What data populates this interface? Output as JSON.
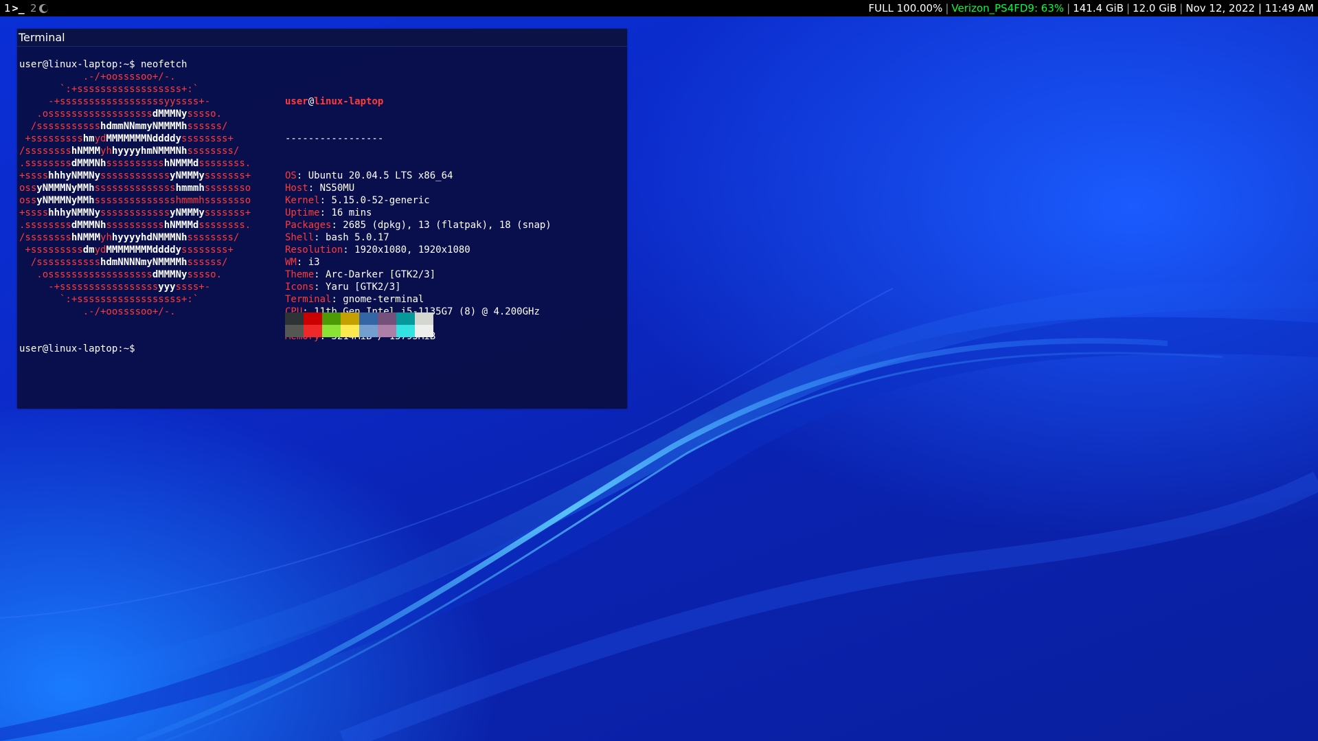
{
  "bar": {
    "workspaces": [
      {
        "num": "1",
        "icon": ">_",
        "focused": true
      },
      {
        "num": "2",
        "icon": "moon-icon",
        "focused": false
      }
    ],
    "status": {
      "battery": "FULL 100.00%",
      "wifi": "Verizon_PS4FD9: 63%",
      "disk": "141.4 GiB",
      "memory": "12.0 GiB",
      "datetime": "Nov 12, 2022 | 11:49 AM"
    },
    "colors": {
      "background": "#000000",
      "wifi_ok": "#00ff3a"
    }
  },
  "terminal": {
    "title": "Terminal",
    "command_line": "user@linux-laptop:~$ neofetch",
    "prompt": "user@linux-laptop:~$",
    "logo_color": "#ff3b3b",
    "logo": [
      [
        [
          "r",
          "           .-/+oossssoo+/-."
        ]
      ],
      [
        [
          "r",
          "       `:+ssssssssssssssssss+:`"
        ]
      ],
      [
        [
          "r",
          "     -+ssssssssssssssssssyyssss+-"
        ]
      ],
      [
        [
          "r",
          "   .ossssssssssssssssss"
        ],
        [
          "w",
          "dMMMNy"
        ],
        [
          "r",
          "sssso."
        ]
      ],
      [
        [
          "r",
          "  /sssssssssss"
        ],
        [
          "w",
          "hdmmNNmmyNMMMMh"
        ],
        [
          "r",
          "ssssss/"
        ]
      ],
      [
        [
          "r",
          " +sssssssss"
        ],
        [
          "w",
          "hm"
        ],
        [
          "r",
          "yd"
        ],
        [
          "w",
          "MMMMMMMNddddy"
        ],
        [
          "r",
          "ssssssss+"
        ]
      ],
      [
        [
          "r",
          "/ssssssss"
        ],
        [
          "w",
          "hNMMM"
        ],
        [
          "r",
          "yh"
        ],
        [
          "w",
          "hyyyyhmNMMMNh"
        ],
        [
          "r",
          "ssssssss/"
        ]
      ],
      [
        [
          "r",
          ".ssssssss"
        ],
        [
          "w",
          "dMMMNh"
        ],
        [
          "r",
          "ssssssssss"
        ],
        [
          "w",
          "hNMMMd"
        ],
        [
          "r",
          "ssssssss."
        ]
      ],
      [
        [
          "r",
          "+ssss"
        ],
        [
          "w",
          "hhhyNMMNy"
        ],
        [
          "r",
          "ssssssssssss"
        ],
        [
          "w",
          "yNMMMy"
        ],
        [
          "r",
          "sssssss+"
        ]
      ],
      [
        [
          "r",
          "oss"
        ],
        [
          "w",
          "yNMMMNyMMh"
        ],
        [
          "r",
          "ssssssssssssss"
        ],
        [
          "w",
          "hmmmh"
        ],
        [
          "r",
          "ssssssso"
        ]
      ],
      [
        [
          "r",
          "oss"
        ],
        [
          "w",
          "yNMMMNyMMh"
        ],
        [
          "r",
          "sssssssssssssshmmmhssssssso"
        ]
      ],
      [
        [
          "r",
          "+ssss"
        ],
        [
          "w",
          "hhhyNMMNy"
        ],
        [
          "r",
          "ssssssssssss"
        ],
        [
          "w",
          "yNMMMy"
        ],
        [
          "r",
          "sssssss+"
        ]
      ],
      [
        [
          "r",
          ".ssssssss"
        ],
        [
          "w",
          "dMMMNh"
        ],
        [
          "r",
          "ssssssssss"
        ],
        [
          "w",
          "hNMMMd"
        ],
        [
          "r",
          "ssssssss."
        ]
      ],
      [
        [
          "r",
          "/ssssssss"
        ],
        [
          "w",
          "hNMMM"
        ],
        [
          "r",
          "yh"
        ],
        [
          "w",
          "hyyyyhdNMMMNh"
        ],
        [
          "r",
          "ssssssss/"
        ]
      ],
      [
        [
          "r",
          " +sssssssss"
        ],
        [
          "w",
          "dm"
        ],
        [
          "r",
          "yd"
        ],
        [
          "w",
          "MMMMMMMMddddy"
        ],
        [
          "r",
          "ssssssss+"
        ]
      ],
      [
        [
          "r",
          "  /sssssssssss"
        ],
        [
          "w",
          "hdmNNNNmyNMMMMh"
        ],
        [
          "r",
          "ssssss/"
        ]
      ],
      [
        [
          "r",
          "   .ossssssssssssssssss"
        ],
        [
          "w",
          "dMMMNy"
        ],
        [
          "r",
          "sssso."
        ]
      ],
      [
        [
          "r",
          "     -+sssssssssssssssss"
        ],
        [
          "w",
          "yyy"
        ],
        [
          "r",
          "ssss+-"
        ]
      ],
      [
        [
          "r",
          "       `:+ssssssssssssssssss+:`"
        ]
      ],
      [
        [
          "r",
          "           .-/+oossssoo+/-."
        ]
      ]
    ],
    "info": {
      "user": "user",
      "at": "@",
      "host": "linux-laptop",
      "separator": "-----------------",
      "rows": [
        {
          "key": "OS",
          "value": "Ubuntu 20.04.5 LTS x86_64"
        },
        {
          "key": "Host",
          "value": "NS50MU"
        },
        {
          "key": "Kernel",
          "value": "5.15.0-52-generic"
        },
        {
          "key": "Uptime",
          "value": "16 mins"
        },
        {
          "key": "Packages",
          "value": "2685 (dpkg), 13 (flatpak), 18 (snap)"
        },
        {
          "key": "Shell",
          "value": "bash 5.0.17"
        },
        {
          "key": "Resolution",
          "value": "1920x1080, 1920x1080"
        },
        {
          "key": "WM",
          "value": "i3"
        },
        {
          "key": "Theme",
          "value": "Arc-Darker [GTK2/3]"
        },
        {
          "key": "Icons",
          "value": "Yaru [GTK2/3]"
        },
        {
          "key": "Terminal",
          "value": "gnome-terminal"
        },
        {
          "key": "CPU",
          "value": "11th Gen Intel i5-1135G7 (8) @ 4.200GHz"
        },
        {
          "key": "GPU",
          "value": "Intel Device 9a49"
        },
        {
          "key": "Memory",
          "value": "3214MiB / 15795MiB"
        }
      ]
    },
    "palette": [
      [
        "#2e3436",
        "#cc0000",
        "#4e9a06",
        "#c4a000",
        "#3465a4",
        "#75507b",
        "#06989a",
        "#d3d7cf"
      ],
      [
        "#555753",
        "#ef2929",
        "#8ae234",
        "#fce94f",
        "#729fcf",
        "#ad7fa8",
        "#34e2e2",
        "#eeeeec"
      ]
    ]
  }
}
